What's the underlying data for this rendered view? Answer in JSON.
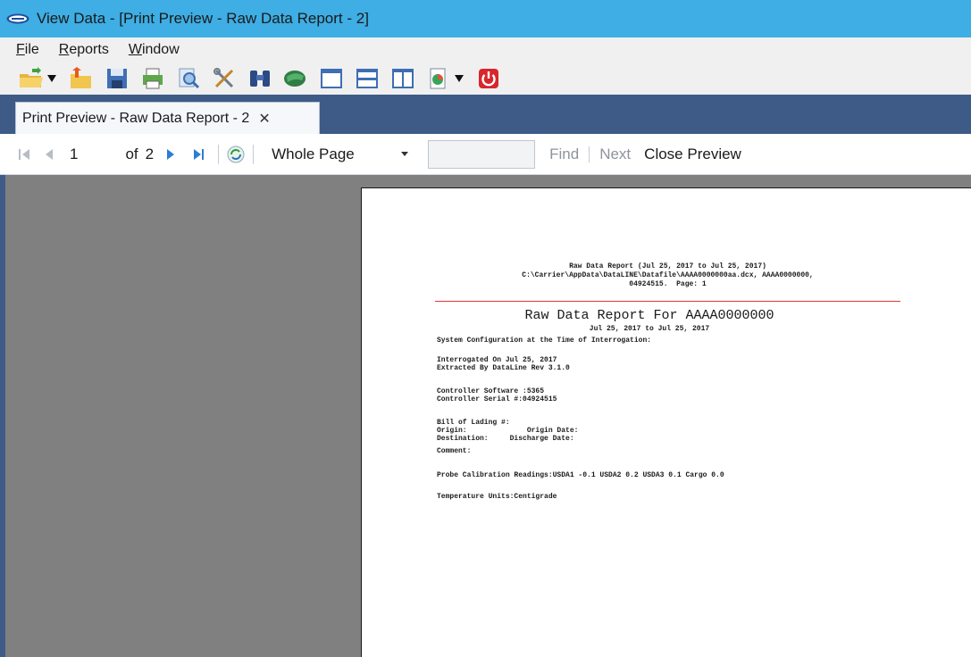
{
  "window": {
    "title": "View Data - [Print Preview - Raw Data Report - 2]",
    "app_icon": "carrier-logo-icon"
  },
  "menu": {
    "items": [
      "File",
      "Reports",
      "Window"
    ]
  },
  "toolbar": {
    "buttons": [
      {
        "name": "open-folder-icon",
        "has_dropdown": true
      },
      {
        "name": "import-folder-icon"
      },
      {
        "name": "save-icon"
      },
      {
        "name": "print-icon"
      },
      {
        "name": "zoom-icon"
      },
      {
        "name": "tools-icon"
      },
      {
        "name": "binoculars-icon"
      },
      {
        "name": "globe-icon"
      },
      {
        "name": "window-icon"
      },
      {
        "name": "split-horizontal-icon"
      },
      {
        "name": "split-vertical-icon"
      },
      {
        "name": "export-icon",
        "has_dropdown": true
      },
      {
        "name": "power-icon"
      }
    ]
  },
  "tab": {
    "label": "Print Preview - Raw Data Report - 2",
    "close_glyph": "✕"
  },
  "preview_toolbar": {
    "current_page": "1",
    "of_label": "of",
    "total_pages": "2",
    "zoom_value": "Whole Page",
    "find_value": "",
    "find_label": "Find",
    "next_label": "Next",
    "close_label": "Close Preview"
  },
  "report": {
    "header_line1": "Raw Data Report (Jul 25, 2017 to Jul 25, 2017)",
    "header_line2": "C:\\Carrier\\AppData\\DataLINE\\Datafile\\AAAA0000000aa.dcx, AAAA0000000,",
    "header_line3": "04924515.  Page: 1",
    "title": "Raw Data Report For AAAA0000000",
    "date_range": "Jul 25, 2017 to Jul 25, 2017",
    "system_config": "System Configuration at the Time of Interrogation:",
    "interrogated": "Interrogated On Jul 25, 2017",
    "extracted": "Extracted By DataLine Rev 3.1.0",
    "controller_software": "Controller Software :5365",
    "controller_serial": "Controller Serial #:04924515",
    "bill_of_lading": "Bill of Lading #:",
    "origin": "Origin:              Origin Date:",
    "destination": "Destination:     Discharge Date:",
    "comment": "Comment:",
    "probe_calibration": "Probe Calibration Readings:USDA1 -0.1 USDA2 0.2 USDA3 0.1 Cargo 0.0",
    "temperature_units": "Temperature Units:Centigrade"
  },
  "colors": {
    "titlebar": "#3eaee4",
    "tabstrip": "#3e5b87",
    "content_bg": "#808080",
    "rule": "#e3343a"
  }
}
